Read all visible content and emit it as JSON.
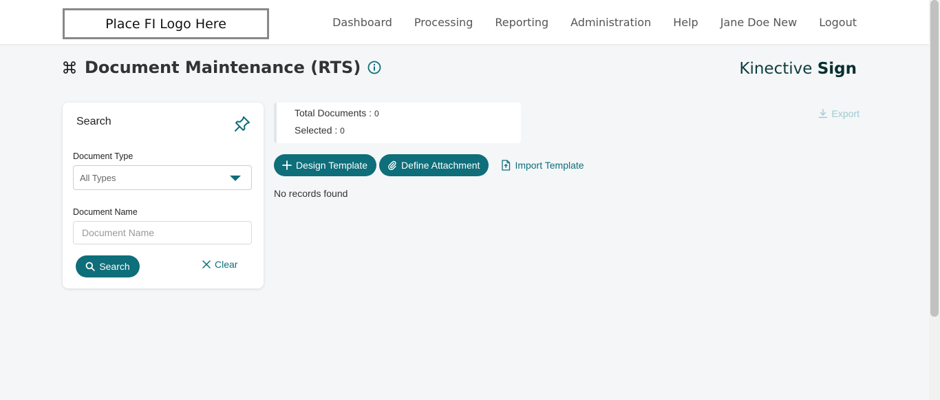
{
  "header": {
    "logo_text": "Place FI Logo Here",
    "nav": [
      "Dashboard",
      "Processing",
      "Reporting",
      "Administration",
      "Help",
      "Jane Doe New",
      "Logout"
    ]
  },
  "page": {
    "title": "Document Maintenance (RTS)",
    "brand_light": "Kinective",
    "brand_bold": "Sign"
  },
  "search": {
    "title": "Search",
    "doc_type_label": "Document Type",
    "doc_type_value": "All Types",
    "doc_name_label": "Document Name",
    "doc_name_placeholder": "Document Name",
    "search_button": "Search",
    "clear_button": "Clear"
  },
  "stats": {
    "total_label": "Total Documents : ",
    "total_value": "0",
    "selected_label": "Selected : ",
    "selected_value": "0"
  },
  "toolbar": {
    "export_label": "Export",
    "design_template": "Design Template",
    "define_attachment": "Define Attachment",
    "import_template": "Import Template"
  },
  "results": {
    "empty_message": "No records found"
  },
  "colors": {
    "accent": "#0e6e7a",
    "export_disabled": "#9fcad0"
  }
}
